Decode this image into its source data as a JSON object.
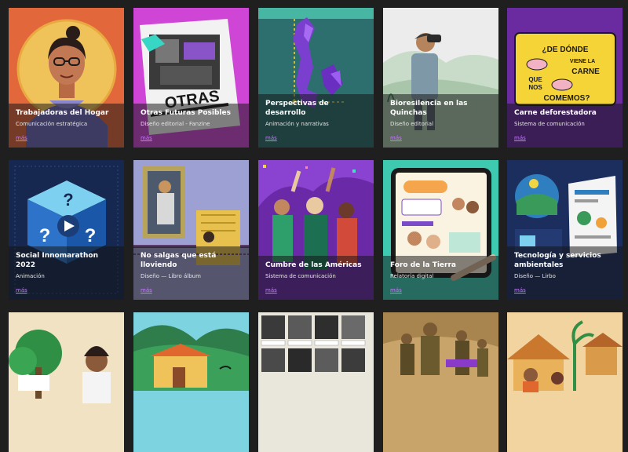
{
  "accent_color": "#c77dff",
  "background_color": "#1f1f1f",
  "projects": [
    {
      "title": "Trabajadoras del Hogar",
      "subtitle": "Comunicación estratégica",
      "link": "más",
      "icon": "woman-portrait-illustration"
    },
    {
      "title": "Otras Futuras Posibles",
      "subtitle": "Diseño editorial - Fanzine",
      "link": "más",
      "icon": "fanzine-cover-illustration"
    },
    {
      "title": "Perspectivas de desarrollo",
      "subtitle": "Animación y narrativas",
      "link": "más",
      "icon": "crystal-tower-illustration"
    },
    {
      "title": "Bioresilencia en las Quinchas",
      "subtitle": "Diseño editorial",
      "link": "más",
      "icon": "birdwatcher-illustration"
    },
    {
      "title": "Carne deforestadora",
      "subtitle": "Sistema de comunicación",
      "link": "más",
      "icon": "meat-poster-illustration",
      "poster_text": "¿DE DÓNDE VIENE LA CARNE QUE NOS COMEMOS?"
    },
    {
      "title": "Social Innomarathon 2022",
      "subtitle": "Animación",
      "link": "más",
      "icon": "question-cube-illustration"
    },
    {
      "title": "No salgas que está lloviendo",
      "subtitle": "Diseño — Libro álbum",
      "link": "más",
      "icon": "window-storybook-illustration"
    },
    {
      "title": "Cumbre de las Américas",
      "subtitle": "Sistema de comunicación",
      "link": "más",
      "icon": "crowd-celebration-illustration"
    },
    {
      "title": "Foro de la Tierra",
      "subtitle": "Relatoría digital",
      "link": "más",
      "icon": "tablet-graphic-recording-illustration"
    },
    {
      "title": "Tecnología y servicios ambientales",
      "subtitle": "Diseño — Lirbo",
      "link": "más",
      "icon": "infographic-book-illustration"
    },
    {
      "title": "",
      "subtitle": "",
      "link": "",
      "icon": "village-trees-illustration"
    },
    {
      "title": "",
      "subtitle": "",
      "link": "",
      "icon": "mountain-house-illustration"
    },
    {
      "title": "",
      "subtitle": "",
      "link": "",
      "icon": "photo-grid-illustration"
    },
    {
      "title": "",
      "subtitle": "",
      "link": "",
      "icon": "soldiers-illustration"
    },
    {
      "title": "",
      "subtitle": "",
      "link": "",
      "icon": "huts-palms-illustration"
    }
  ]
}
